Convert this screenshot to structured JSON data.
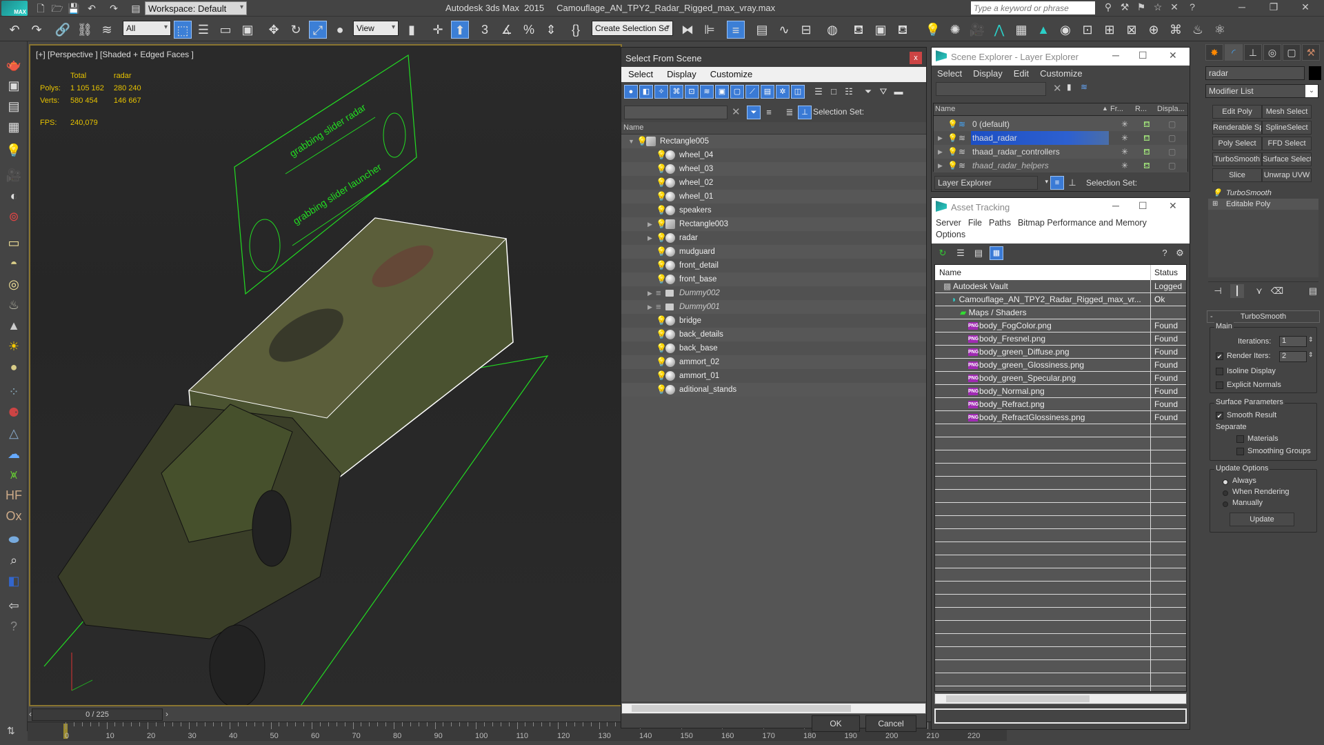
{
  "titlebar": {
    "app_logo": "MAX",
    "workspace": "Workspace: Default",
    "app_title": "Autodesk 3ds Max  2015",
    "file_name": "Camouflage_AN_TPY2_Radar_Rigged_max_vray.max",
    "search_placeholder": "Type a keyword or phrase"
  },
  "toolbar": {
    "selection_filter": "All",
    "ref_coord": "View",
    "named_selection_placeholder": "Create Selection Se"
  },
  "viewport": {
    "label": "[+] [Perspective ] [Shaded + Edged Faces ]",
    "stats": {
      "col_total": "Total",
      "col_selected": "radar",
      "polys_label": "Polys:",
      "polys_total": "1 105 162",
      "polys_selected": "280 240",
      "verts_label": "Verts:",
      "verts_total": "580 454",
      "verts_selected": "146 667",
      "fps_label": "FPS:",
      "fps_value": "240,079"
    }
  },
  "timeline": {
    "frame_display": "0 / 225",
    "ticks": [
      "0",
      "10",
      "20",
      "30",
      "40",
      "50",
      "60",
      "70",
      "80",
      "90",
      "100",
      "110",
      "120",
      "130",
      "140",
      "150",
      "160",
      "170",
      "180",
      "190",
      "200",
      "210",
      "220"
    ]
  },
  "select_from_scene": {
    "title": "Select From Scene",
    "menu": [
      "Select",
      "Display",
      "Customize"
    ],
    "selection_set_label": "Selection Set:",
    "column_name": "Name",
    "items": [
      {
        "name": "Rectangle005",
        "type": "group",
        "expanded": true,
        "level": 0
      },
      {
        "name": "wheel_04",
        "type": "geometry",
        "level": 1
      },
      {
        "name": "wheel_03",
        "type": "geometry",
        "level": 1
      },
      {
        "name": "wheel_02",
        "type": "geometry",
        "level": 1
      },
      {
        "name": "wheel_01",
        "type": "geometry",
        "level": 1
      },
      {
        "name": "speakers",
        "type": "geometry",
        "level": 1
      },
      {
        "name": "Rectangle003",
        "type": "group",
        "collapsed": true,
        "level": 1
      },
      {
        "name": "radar",
        "type": "geometry",
        "collapsed": true,
        "level": 1
      },
      {
        "name": "mudguard",
        "type": "geometry",
        "level": 1
      },
      {
        "name": "front_detail",
        "type": "geometry",
        "level": 1
      },
      {
        "name": "front_base",
        "type": "geometry",
        "level": 1
      },
      {
        "name": "Dummy002",
        "type": "dummy",
        "collapsed": true,
        "level": 1
      },
      {
        "name": "Dummy001",
        "type": "dummy",
        "collapsed": true,
        "level": 1
      },
      {
        "name": "bridge",
        "type": "geometry",
        "level": 1
      },
      {
        "name": "back_details",
        "type": "geometry",
        "level": 1
      },
      {
        "name": "back_base",
        "type": "geometry",
        "level": 1
      },
      {
        "name": "ammort_02",
        "type": "geometry",
        "level": 1
      },
      {
        "name": "ammort_01",
        "type": "geometry",
        "level": 1
      },
      {
        "name": "aditional_stands",
        "type": "geometry",
        "level": 1
      }
    ],
    "ok_label": "OK",
    "cancel_label": "Cancel"
  },
  "scene_explorer": {
    "title": "Scene Explorer - Layer Explorer",
    "menu": [
      "Select",
      "Display",
      "Edit",
      "Customize"
    ],
    "columns": [
      "Name",
      "Fr...",
      "R...",
      "Displa..."
    ],
    "layers": [
      {
        "name": "0 (default)",
        "selected": false,
        "hidden": false
      },
      {
        "name": "thaad_radar",
        "selected": true,
        "hidden": false
      },
      {
        "name": "thaad_radar_controllers",
        "selected": false,
        "hidden": false
      },
      {
        "name": "thaad_radar_helpers",
        "selected": false,
        "hidden": true
      }
    ],
    "mode": "Layer Explorer",
    "selection_set_label": "Selection Set:"
  },
  "asset_tracking": {
    "title": "Asset Tracking",
    "menu_row1": [
      "Server",
      "File",
      "Paths",
      "Bitmap Performance and Memory"
    ],
    "menu_row2": [
      "Options"
    ],
    "columns": [
      "Name",
      "Status"
    ],
    "rows": [
      {
        "name": "Autodesk Vault",
        "status": "Logged O",
        "indent": 1,
        "icon": "vault"
      },
      {
        "name": "Camouflage_AN_TPY2_Radar_Rigged_max_vr...",
        "status": "Ok",
        "indent": 2,
        "icon": "max"
      },
      {
        "name": "Maps / Shaders",
        "status": "",
        "indent": 3,
        "icon": "maps"
      },
      {
        "name": "body_FogColor.png",
        "status": "Found",
        "indent": 4,
        "icon": "png"
      },
      {
        "name": "body_Fresnel.png",
        "status": "Found",
        "indent": 4,
        "icon": "png"
      },
      {
        "name": "body_green_Diffuse.png",
        "status": "Found",
        "indent": 4,
        "icon": "png"
      },
      {
        "name": "body_green_Glossiness.png",
        "status": "Found",
        "indent": 4,
        "icon": "png"
      },
      {
        "name": "body_green_Specular.png",
        "status": "Found",
        "indent": 4,
        "icon": "png"
      },
      {
        "name": "body_Normal.png",
        "status": "Found",
        "indent": 4,
        "icon": "png"
      },
      {
        "name": "body_Refract.png",
        "status": "Found",
        "indent": 4,
        "icon": "png"
      },
      {
        "name": "body_RefractGlossiness.png",
        "status": "Found",
        "indent": 4,
        "icon": "png"
      }
    ]
  },
  "command_panel": {
    "object_name": "radar",
    "modifier_list": "Modifier List",
    "modifier_buttons": [
      "Edit Poly",
      "Mesh Select",
      "Renderable Spline",
      "SplineSelect",
      "Poly Select",
      "FFD Select",
      "TurboSmooth",
      "Surface Select",
      "Slice",
      "Unwrap UVW"
    ],
    "stack": [
      "TurboSmooth",
      "Editable Poly"
    ],
    "rollout_title": "TurboSmooth",
    "main_group": "Main",
    "iterations_label": "Iterations:",
    "iterations_value": "1",
    "render_iters_label": "Render Iters:",
    "render_iters_value": "2",
    "render_iters_checked": true,
    "isoline_label": "Isoline Display",
    "isoline_checked": false,
    "explicit_normals_label": "Explicit Normals",
    "explicit_normals_checked": false,
    "surface_group": "Surface Parameters",
    "smooth_result_label": "Smooth Result",
    "smooth_result_checked": true,
    "separate_label": "Separate",
    "materials_label": "Materials",
    "smoothing_groups_label": "Smoothing Groups",
    "update_group": "Update Options",
    "update_options": [
      "Always",
      "When Rendering",
      "Manually"
    ],
    "update_selected": "Always",
    "update_button": "Update"
  },
  "colors": {
    "accent_blue": "#3c7fd6",
    "selection_blue": "#1d4fc4",
    "stats_yellow": "#e6c200",
    "viewport_border": "#8a7530",
    "close_red": "#c44444",
    "wire_green": "#22dd22"
  }
}
